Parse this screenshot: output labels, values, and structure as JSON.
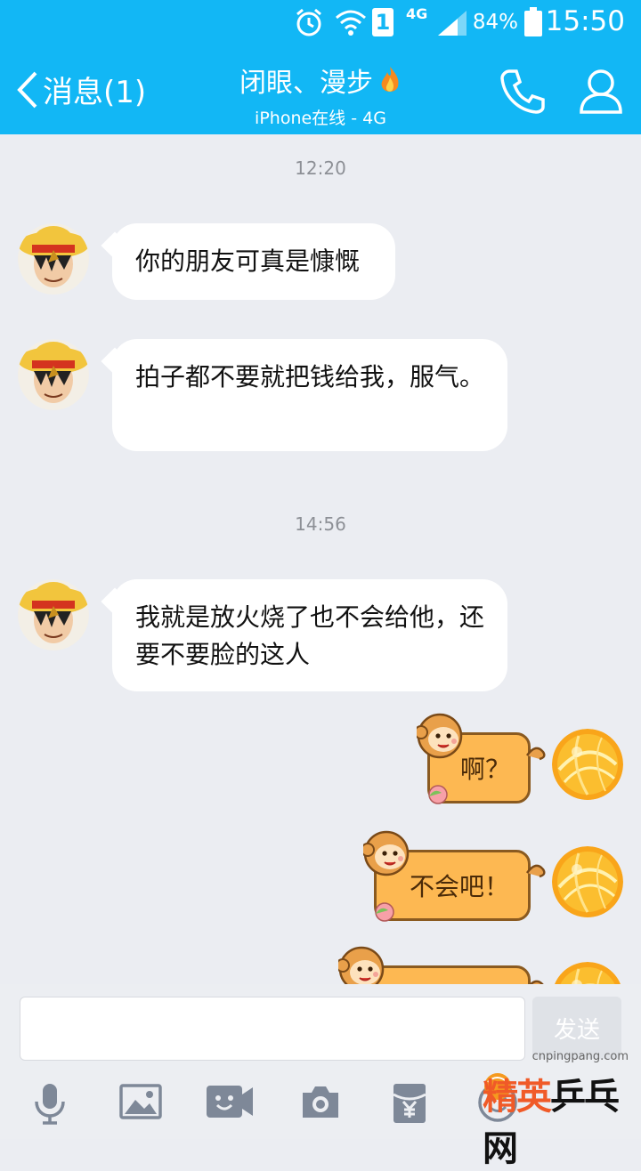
{
  "status_bar": {
    "sim": "1",
    "network": "4G",
    "battery": "84%",
    "time": "15:50"
  },
  "nav": {
    "back_label": "消息(1)",
    "contact_name": "闭眼、漫步",
    "contact_status": "iPhone在线 - 4G"
  },
  "timestamps": [
    "12:20",
    "14:56"
  ],
  "messages": [
    {
      "text": "你的朋友可真是慷慨"
    },
    {
      "text": "拍子都不要就把钱给我，服气。"
    },
    {
      "text": "我就是放火烧了也不会给他，还要不要脸的这人"
    },
    {
      "text": "啊？"
    },
    {
      "text": "不会吧！"
    }
  ],
  "input": {
    "value": "",
    "send_label": "发送"
  },
  "watermark": {
    "url": "cnpingpang.com",
    "brand_a": "精英",
    "brand_b": "乒乓网"
  },
  "colors": {
    "header": "#12b7f5",
    "background": "#ebedf2",
    "bubble_in": "#ffffff",
    "bubble_out": "#fdb852"
  }
}
